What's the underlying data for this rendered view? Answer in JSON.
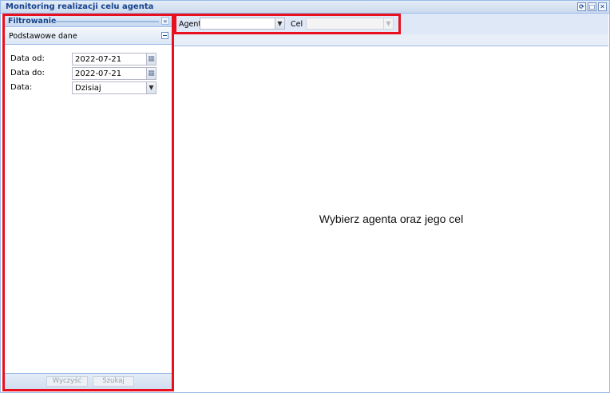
{
  "window": {
    "title": "Monitoring realizacji celu agenta",
    "tools": [
      "refresh-icon",
      "maximize-icon",
      "close-icon"
    ]
  },
  "filter_panel": {
    "title": "Filtrowanie",
    "section_title": "Podstawowe dane",
    "fields": {
      "date_from": {
        "label": "Data od:",
        "value": "2022-07-21"
      },
      "date_to": {
        "label": "Data do:",
        "value": "2022-07-21"
      },
      "date_preset": {
        "label": "Data:",
        "value": "Dzisiaj"
      }
    },
    "buttons": {
      "clear": "Wyczyść",
      "search": "Szukaj"
    }
  },
  "toolbar": {
    "agent_label": "Agent",
    "agent_value": "",
    "goal_label": "Cel",
    "goal_value": ""
  },
  "main": {
    "empty_message": "Wybierz agenta oraz jego cel"
  },
  "colors": {
    "highlight_border": "#e8101e",
    "panel_header": "#15428b",
    "panel_border": "#99bbe8"
  }
}
